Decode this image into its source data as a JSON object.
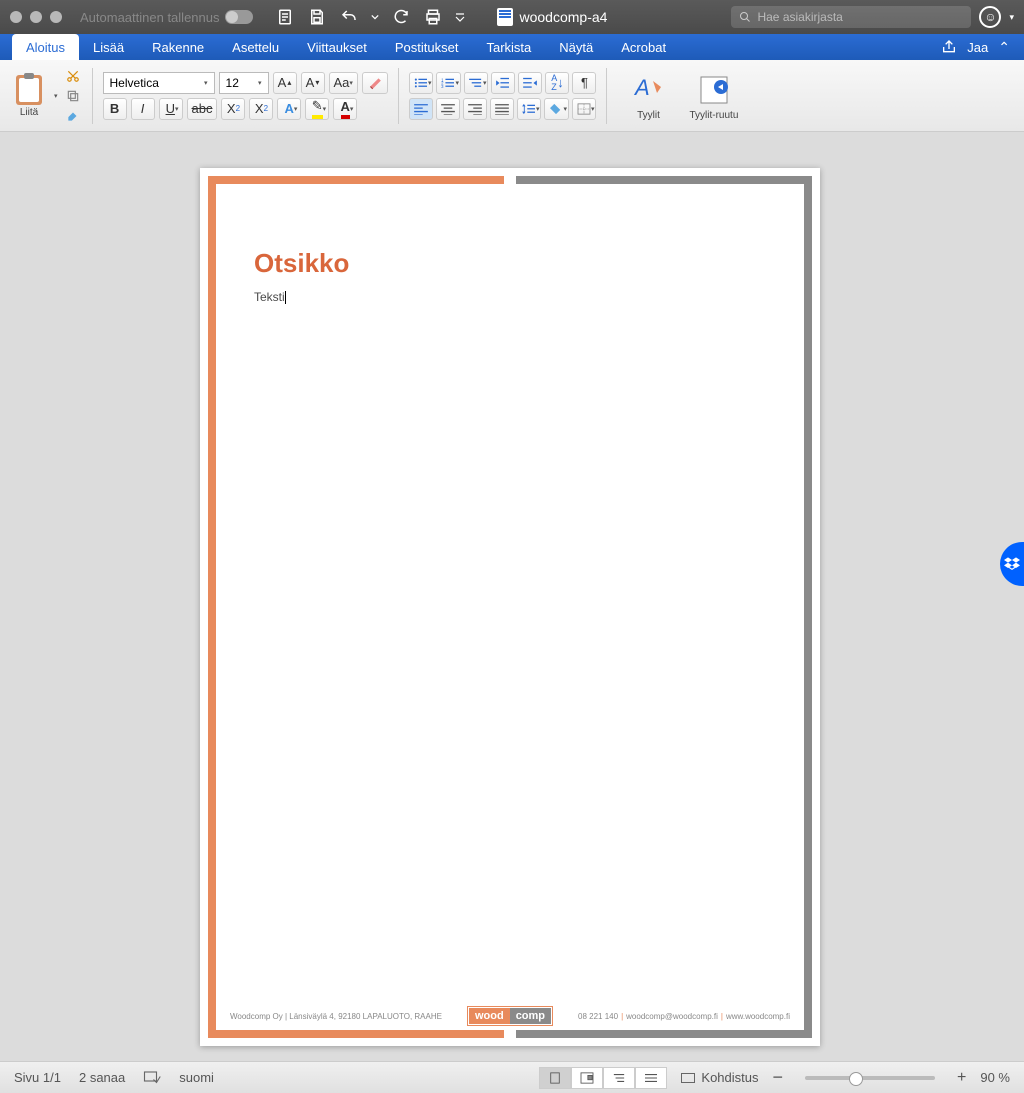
{
  "titlebar": {
    "autosave_label": "Automaattinen tallennus",
    "doc_name": "woodcomp-a4",
    "search_placeholder": "Hae asiakirjasta"
  },
  "ribbon": {
    "tabs": [
      "Aloitus",
      "Lisää",
      "Rakenne",
      "Asettelu",
      "Viittaukset",
      "Postitukset",
      "Tarkista",
      "Näytä",
      "Acrobat"
    ],
    "share_label": "Jaa"
  },
  "toolbar": {
    "paste_label": "Liitä",
    "font_name": "Helvetica",
    "font_size": "12",
    "styles_label": "Tyylit",
    "styles_pane_label": "Tyylit-ruutu"
  },
  "document": {
    "title": "Otsikko",
    "body": "Teksti",
    "footer_left": "Woodcomp Oy  |  Länsiväylä 4, 92180 LAPALUOTO, RAAHE",
    "footer_logo_left": "wood",
    "footer_logo_right": "comp",
    "footer_phone": "08 221 140",
    "footer_email": "woodcomp@woodcomp.fi",
    "footer_web": "www.woodcomp.fi"
  },
  "statusbar": {
    "page": "Sivu 1/1",
    "words": "2 sanaa",
    "language": "suomi",
    "focus_label": "Kohdistus",
    "zoom": "90 %"
  }
}
